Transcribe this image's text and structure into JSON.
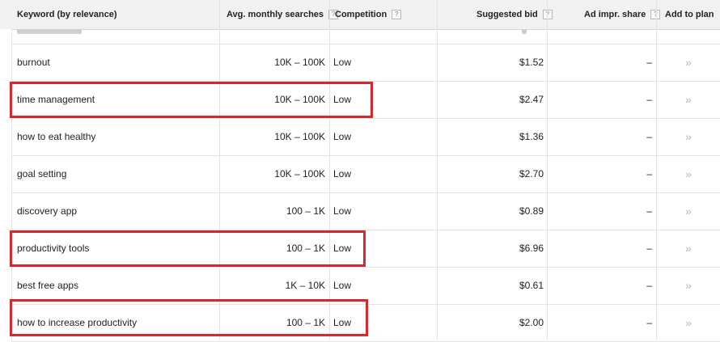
{
  "columns": {
    "keyword": "Keyword (by relevance)",
    "searches": "Avg. monthly searches",
    "competition": "Competition",
    "bid": "Suggested bid",
    "impr": "Ad impr. share",
    "add": "Add to plan",
    "help": "?"
  },
  "add_glyph": "»",
  "rows": [
    {
      "keyword": "burnout",
      "searches": "10K – 100K",
      "competition": "Low",
      "bid": "$1.52",
      "impr": "–"
    },
    {
      "keyword": "time management",
      "searches": "10K – 100K",
      "competition": "Low",
      "bid": "$2.47",
      "impr": "–"
    },
    {
      "keyword": "how to eat healthy",
      "searches": "10K – 100K",
      "competition": "Low",
      "bid": "$1.36",
      "impr": "–"
    },
    {
      "keyword": "goal setting",
      "searches": "10K – 100K",
      "competition": "Low",
      "bid": "$2.70",
      "impr": "–"
    },
    {
      "keyword": "discovery app",
      "searches": "100 – 1K",
      "competition": "Low",
      "bid": "$0.89",
      "impr": "–"
    },
    {
      "keyword": "productivity tools",
      "searches": "100 – 1K",
      "competition": "Low",
      "bid": "$6.96",
      "impr": "–"
    },
    {
      "keyword": "best free apps",
      "searches": "1K – 10K",
      "competition": "Low",
      "bid": "$0.61",
      "impr": "–"
    },
    {
      "keyword": "how to increase productivity",
      "searches": "100 – 1K",
      "competition": "Low",
      "bid": "$2.00",
      "impr": "–"
    }
  ],
  "highlight_color": "#d42a2f"
}
